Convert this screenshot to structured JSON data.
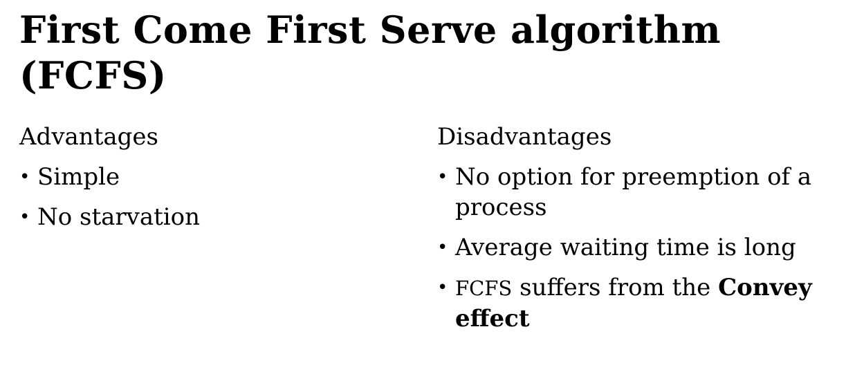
{
  "slide": {
    "title": "First Come First Serve algorithm (FCFS)"
  },
  "advantages": {
    "heading": "Advantages",
    "items": [
      "Simple",
      "No starvation"
    ]
  },
  "disadvantages": {
    "heading": "Disadvantages",
    "items": [
      "No option for preemption of a process",
      "Average waiting time is long"
    ],
    "last_item": {
      "prefix": "FCFS",
      "middle": " suffers from the ",
      "emphasis": "Convey effect"
    }
  },
  "bullet_glyph": "•"
}
